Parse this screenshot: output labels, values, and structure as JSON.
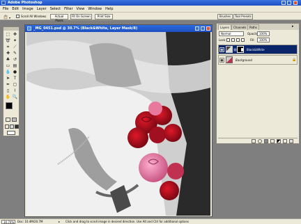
{
  "app": {
    "title": "Adobe Photoshop"
  },
  "menu": [
    "File",
    "Edit",
    "Image",
    "Layer",
    "Select",
    "Filter",
    "View",
    "Window",
    "Help"
  ],
  "options_bar": {
    "scroll_all_windows": "Scroll All Windows",
    "actual_pixels": "Actual Pixels",
    "fit_on_screen": "Fit On Screen",
    "print_size": "Print Size"
  },
  "palette_well": {
    "tabs": [
      "Brushes",
      "Tool Presets"
    ]
  },
  "document": {
    "title": "_MG_0451.psd @ 30.7% (Black&White, Layer Mask/8)"
  },
  "layers_palette": {
    "tabs": [
      "Layers",
      "Channels",
      "Paths"
    ],
    "blend_mode": "Normal",
    "opacity_label": "Opacity:",
    "opacity_value": "100%",
    "lock_label": "Lock:",
    "fill_label": "Fill:",
    "fill_value": "100%",
    "layers": [
      {
        "name": "Black&White",
        "selected": true
      },
      {
        "name": "Background",
        "locked": true
      }
    ]
  },
  "status_bar": {
    "zoom": "30.74%",
    "doc_size": "Doc: 10.4M/20.7M",
    "hint": "Click and drag to scroll image in desired direction.  Use Alt and Ctrl for additional options"
  },
  "colors": {
    "titlebar": "#1c4fc4",
    "chrome": "#ece9d8",
    "workspace": "#7f7f7f",
    "rose_red": "#b0101c",
    "rose_pink": "#e67aa8"
  }
}
